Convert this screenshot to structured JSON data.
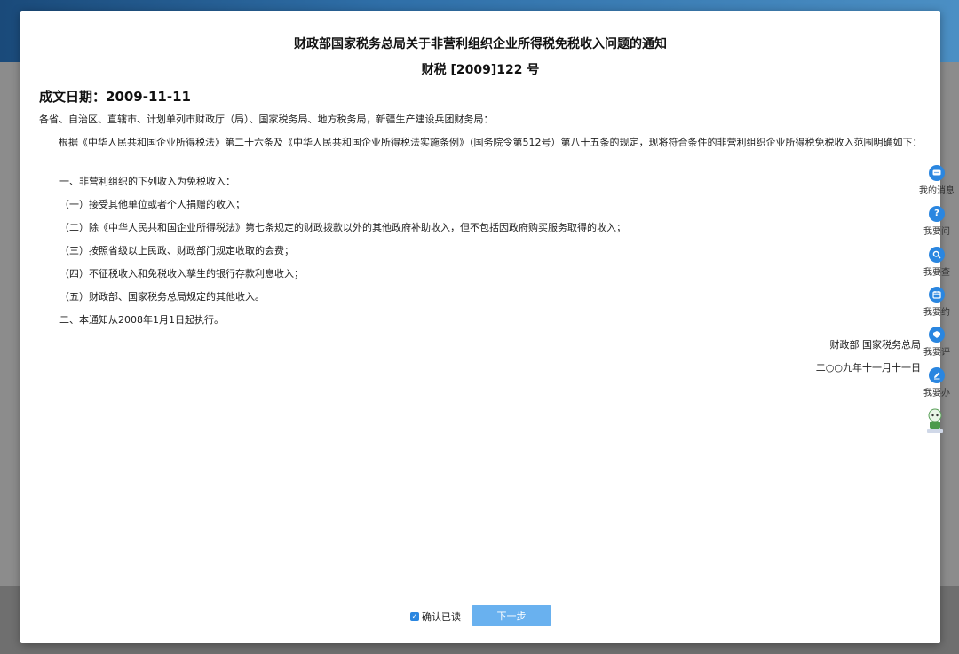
{
  "document": {
    "title": "财政部国家税务总局关于非营利组织企业所得税免税收入问题的通知",
    "number": "财税 [2009]122 号",
    "date_label": "成文日期：2009-11-11",
    "addressee": "各省、自治区、直辖市、计划单列市财政厅（局）、国家税务局、地方税务局，新疆生产建设兵团财务局：",
    "basis": "根据《中华人民共和国企业所得税法》第二十六条及《中华人民共和国企业所得税法实施条例》（国务院令第512号）第八十五条的规定，现将符合条件的非营利组织企业所得税免税收入范围明确如下：",
    "items": [
      "一、非营利组织的下列收入为免税收入：",
      "（一）接受其他单位或者个人捐赠的收入；",
      "（二）除《中华人民共和国企业所得税法》第七条规定的财政拨款以外的其他政府补助收入，但不包括因政府购买服务取得的收入；",
      "（三）按照省级以上民政、财政部门规定收取的会费；",
      "（四）不征税收入和免税收入孳生的银行存款利息收入；",
      "（五）财政部、国家税务总局规定的其他收入。",
      "二、本通知从2008年1月1日起执行。"
    ],
    "signature_org": "财政部 国家税务总局",
    "signature_date": "二○○九年十一月十一日"
  },
  "footer": {
    "confirm_label": "确认已读",
    "next_label": "下一步"
  },
  "sidebar": {
    "items": [
      {
        "label": "我的消息",
        "icon": "message-icon"
      },
      {
        "label": "我要问",
        "icon": "question-icon"
      },
      {
        "label": "我要查",
        "icon": "search-icon"
      },
      {
        "label": "我要约",
        "icon": "calendar-icon"
      },
      {
        "label": "我要评",
        "icon": "rating-icon"
      },
      {
        "label": "我要办",
        "icon": "edit-icon"
      }
    ],
    "robot_icon": "assistant-robot-icon"
  },
  "colors": {
    "accent": "#2a86e0",
    "button": "#69b1ef"
  }
}
